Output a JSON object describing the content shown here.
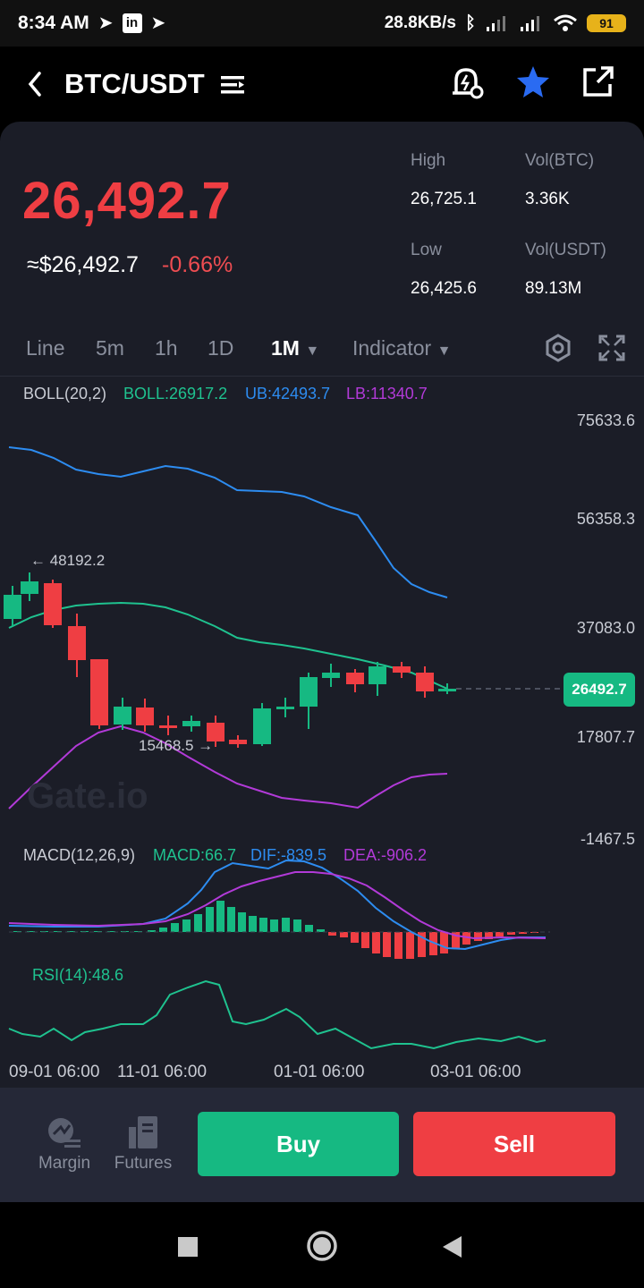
{
  "status": {
    "time": "8:34 AM",
    "speed": "28.8KB/s",
    "battery": "91"
  },
  "header": {
    "pair": "BTC/USDT"
  },
  "ticker": {
    "price": "26,492.7",
    "usd": "≈$26,492.7",
    "change": "-0.66%",
    "high_label": "High",
    "high": "26,725.1",
    "low_label": "Low",
    "low": "26,425.6",
    "vol_btc_label": "Vol(BTC)",
    "vol_btc": "3.36K",
    "vol_usdt_label": "Vol(USDT)",
    "vol_usdt": "89.13M"
  },
  "timeframes": {
    "line": "Line",
    "m5": "5m",
    "h1": "1h",
    "d1": "1D",
    "mo1": "1M",
    "indicator": "Indicator"
  },
  "boll": {
    "name": "BOLL(20,2)",
    "boll": "BOLL:26917.2",
    "ub": "UB:42493.7",
    "lb": "LB:11340.7"
  },
  "axis": {
    "a1": "75633.6",
    "a2": "56358.3",
    "a3": "37083.0",
    "a4": "17807.7",
    "a5": "-1467.5"
  },
  "current_price_tag": "26492.7",
  "annotations": {
    "high_mark": "← 48192.2",
    "low_mark": "15468.5 →"
  },
  "watermark": "Gate.io",
  "macd": {
    "name": "MACD(12,26,9)",
    "macd": "MACD:66.7",
    "dif": "DIF:-839.5",
    "dea": "DEA:-906.2"
  },
  "rsi": {
    "name": "RSI(14):48.6"
  },
  "xaxis": {
    "x1": "09-01 06:00",
    "x2": "11-01 06:00",
    "x3": "01-01 06:00",
    "x4": "03-01 06:00"
  },
  "bottom": {
    "margin": "Margin",
    "futures": "Futures",
    "buy": "Buy",
    "sell": "Sell"
  },
  "colors": {
    "up": "#16b982",
    "down": "#ef3e43",
    "boll_mid": "#1fc28f",
    "boll_ub": "#2d8cf0",
    "boll_lb": "#b23ad8"
  }
}
